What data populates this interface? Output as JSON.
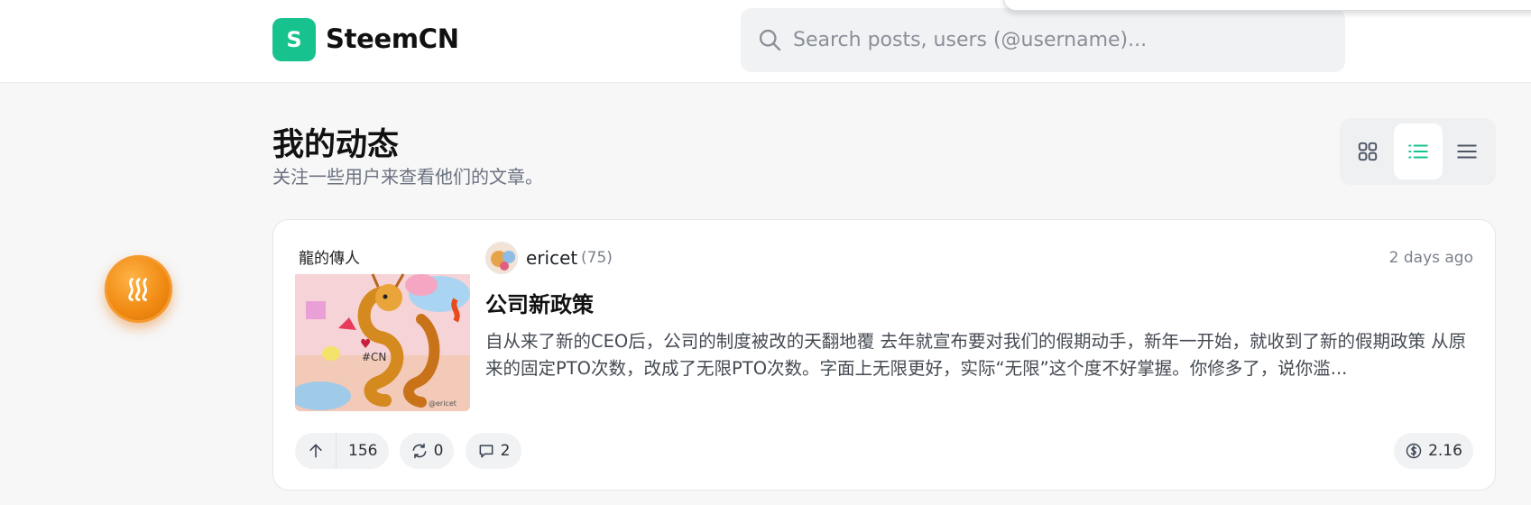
{
  "header": {
    "logo_letter": "S",
    "brand_name": "SteemCN",
    "search": {
      "placeholder": "Search posts, users (@username)..."
    }
  },
  "feed": {
    "title": "我的动态",
    "subtitle": "关注一些用户来查看他们的文章。",
    "view_modes": [
      {
        "icon": "grid-icon",
        "active": false
      },
      {
        "icon": "list-icon",
        "active": true
      },
      {
        "icon": "compact-list-icon",
        "active": false
      }
    ]
  },
  "post": {
    "author": "ericet",
    "reputation": "(75)",
    "time": "2 days ago",
    "title": "公司新政策",
    "excerpt": "自从来了新的CEO后，公司的制度被改的天翻地覆 去年就宣布要对我们的假期动手，新年一开始，就收到了新的假期政策 从原来的固定PTO次数，改成了无限PTO次数。字面上无限更好，实际“无限”这个度不好掌握。你修多了，说你滥...",
    "thumbnail_caption": "龍的傳人",
    "votes": "156",
    "resteems": "0",
    "comments": "2",
    "payout": "2.16"
  },
  "colors": {
    "accent": "#17c28e",
    "steem_orange": "#f08a12"
  }
}
